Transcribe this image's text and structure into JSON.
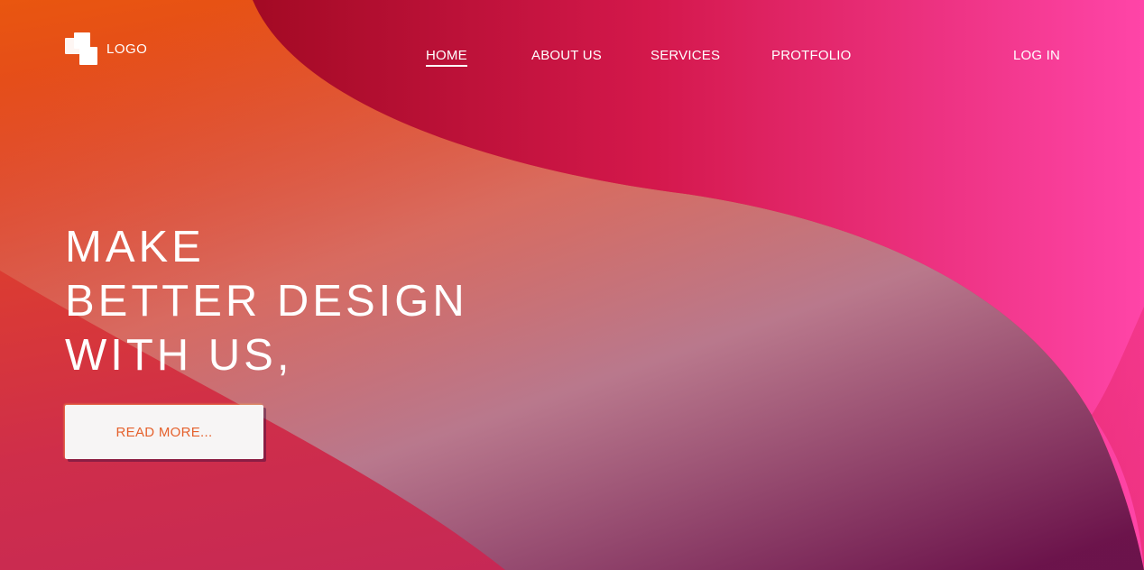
{
  "brand": {
    "logo_text": "LOGO"
  },
  "nav": {
    "items": [
      {
        "label": "HOME",
        "active": true
      },
      {
        "label": "ABOUT US",
        "active": false
      },
      {
        "label": "SERVICES",
        "active": false
      },
      {
        "label": "PROTFOLIO",
        "active": false
      }
    ],
    "login_label": "LOG IN"
  },
  "hero": {
    "lines": [
      "MAKE",
      "BETTER DESIGN",
      "WITH US,"
    ],
    "cta_label": "READ MORE..."
  },
  "colors": {
    "orange": "#e9560f",
    "crimson": "#a30a24",
    "pink": "#ff45a8",
    "plum": "#5c1048",
    "button_text": "#e5612c"
  }
}
